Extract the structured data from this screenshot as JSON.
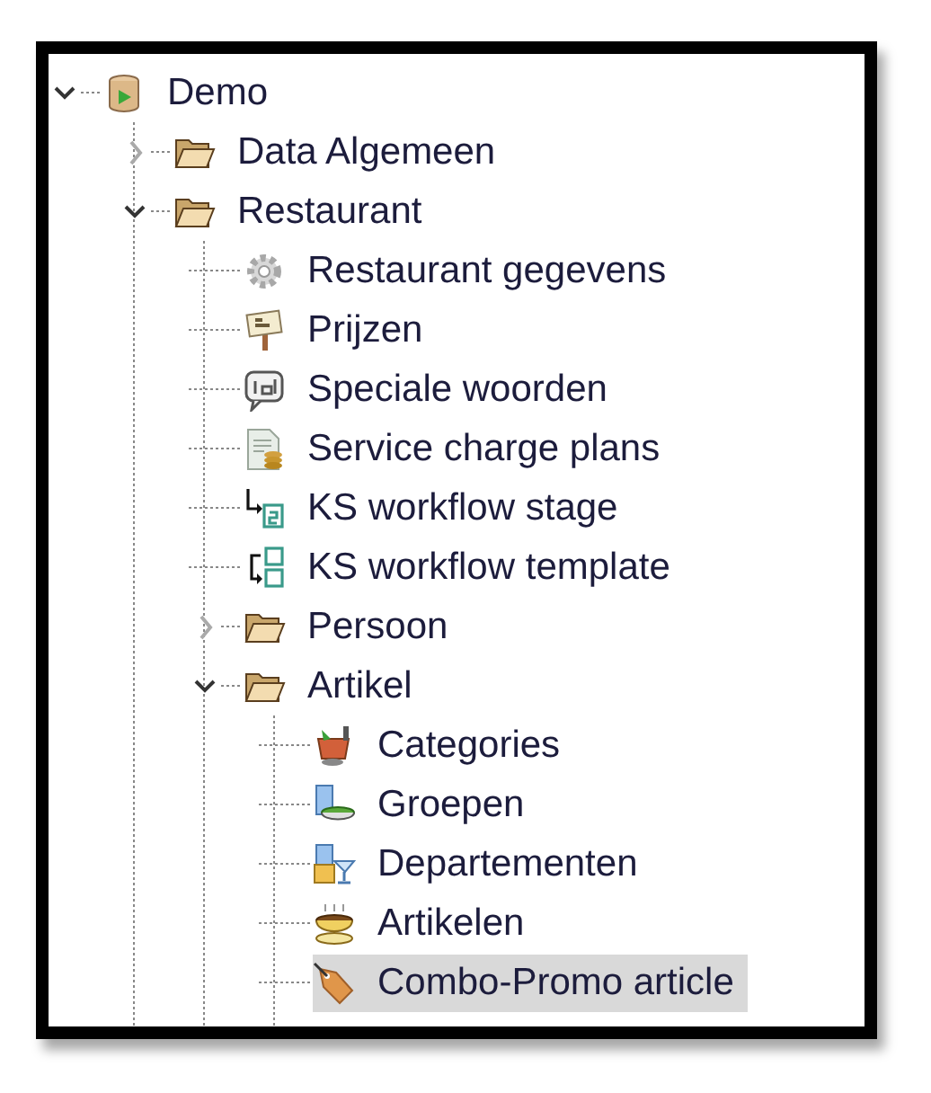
{
  "tree": [
    {
      "label": "Demo",
      "kind": "database",
      "expanded": true,
      "selected": false,
      "children": [
        {
          "label": "Data Algemeen",
          "kind": "folder",
          "expanded": false,
          "selected": false
        },
        {
          "label": "Restaurant",
          "kind": "folder",
          "expanded": true,
          "selected": false,
          "children": [
            {
              "label": "Restaurant gegevens",
              "kind": "gear",
              "selected": false
            },
            {
              "label": "Prijzen",
              "kind": "price",
              "selected": false
            },
            {
              "label": "Speciale woorden",
              "kind": "speech",
              "selected": false
            },
            {
              "label": "Service charge plans",
              "kind": "document",
              "selected": false
            },
            {
              "label": "KS workflow stage",
              "kind": "stage",
              "selected": false
            },
            {
              "label": "KS workflow template",
              "kind": "template",
              "selected": false
            },
            {
              "label": "Persoon",
              "kind": "folder",
              "expanded": false,
              "selected": false
            },
            {
              "label": "Artikel",
              "kind": "folder",
              "expanded": true,
              "selected": false,
              "children": [
                {
                  "label": "Categories",
                  "kind": "category",
                  "selected": false
                },
                {
                  "label": "Groepen",
                  "kind": "group",
                  "selected": false
                },
                {
                  "label": "Departementen",
                  "kind": "department",
                  "selected": false
                },
                {
                  "label": "Artikelen",
                  "kind": "article",
                  "selected": false
                },
                {
                  "label": "Combo-Promo article",
                  "kind": "tag",
                  "selected": true
                }
              ]
            }
          ]
        }
      ]
    }
  ]
}
